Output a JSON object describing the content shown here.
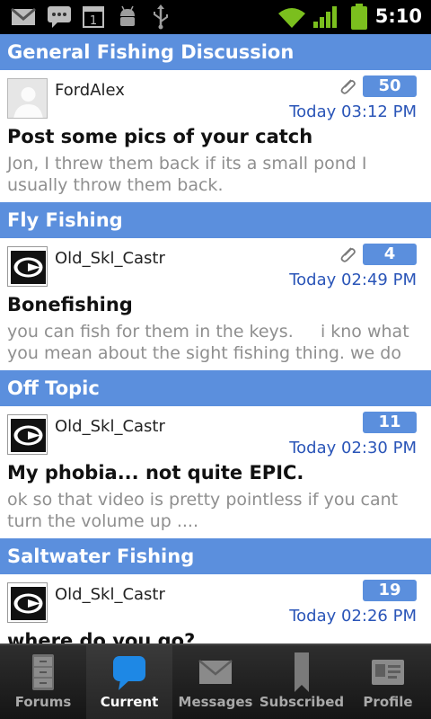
{
  "status_bar": {
    "time": "5:10",
    "icons": [
      "gmail-icon",
      "sms-icon",
      "calendar-icon",
      "android-debug-icon",
      "usb-icon",
      "wifi-icon",
      "signal-icon",
      "battery-icon"
    ],
    "calendar_day": "1"
  },
  "sections": [
    {
      "header": "General Fishing Discussion",
      "post": {
        "user": "FordAlex",
        "avatar": "default-avatar",
        "has_attachment": true,
        "count": "50",
        "time": "Today 03:12 PM",
        "title": "Post some pics of your catch",
        "snippet": "Jon, I threw them back if its a small pond I usually throw them back."
      }
    },
    {
      "header": "Fly Fishing",
      "post": {
        "user": "Old_Skl_Castr",
        "avatar": "logo-avatar",
        "has_attachment": true,
        "count": "4",
        "time": "Today 02:49 PM",
        "title": "Bonefishing",
        "snippet": "you can fish for them in the keys.     i kno what you mean about the sight fishing thing. we do"
      }
    },
    {
      "header": "Off Topic",
      "post": {
        "user": "Old_Skl_Castr",
        "avatar": "logo-avatar",
        "has_attachment": false,
        "count": "11",
        "time": "Today 02:30 PM",
        "title": "My phobia... not quite EPIC.",
        "snippet": "ok so that video is pretty pointless if you cant turn the volume up ...."
      }
    },
    {
      "header": "Saltwater Fishing",
      "post": {
        "user": "Old_Skl_Castr",
        "avatar": "logo-avatar",
        "has_attachment": false,
        "count": "19",
        "time": "Today 02:26 PM",
        "title": "where do you go?",
        "snippet": ""
      }
    }
  ],
  "nav": {
    "active": "Current",
    "items": [
      {
        "label": "Forums",
        "icon": "cabinet-icon"
      },
      {
        "label": "Current",
        "icon": "chat-bubble-icon"
      },
      {
        "label": "Messages",
        "icon": "envelope-icon"
      },
      {
        "label": "Subscribed",
        "icon": "bookmark-icon"
      },
      {
        "label": "Profile",
        "icon": "id-card-icon"
      }
    ]
  },
  "colors": {
    "section_header": "#5b8fdd",
    "badge": "#5b8fdd",
    "timestamp": "#2a55b8",
    "snippet": "#8f8f8f",
    "nav_active_icon": "#1e88e5"
  }
}
